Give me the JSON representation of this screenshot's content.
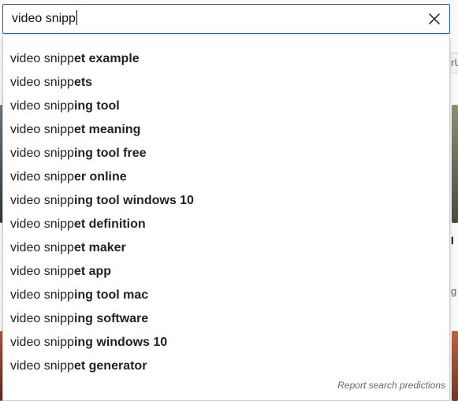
{
  "search": {
    "query": "video snipp",
    "placeholder": ""
  },
  "suggestions": [
    {
      "prefix": "video snipp",
      "completion": "et example"
    },
    {
      "prefix": "video snipp",
      "completion": "ets"
    },
    {
      "prefix": "video snipp",
      "completion": "ing tool"
    },
    {
      "prefix": "video snipp",
      "completion": "et meaning"
    },
    {
      "prefix": "video snipp",
      "completion": "ing tool free"
    },
    {
      "prefix": "video snipp",
      "completion": "er online"
    },
    {
      "prefix": "video snipp",
      "completion": "ing tool windows 10"
    },
    {
      "prefix": "video snipp",
      "completion": "et definition"
    },
    {
      "prefix": "video snipp",
      "completion": "et maker"
    },
    {
      "prefix": "video snipp",
      "completion": "et app"
    },
    {
      "prefix": "video snipp",
      "completion": "ing tool mac"
    },
    {
      "prefix": "video snipp",
      "completion": "ing software"
    },
    {
      "prefix": "video snipp",
      "completion": "ing windows 10"
    },
    {
      "prefix": "video snipp",
      "completion": "et generator"
    }
  ],
  "footer": {
    "report_label": "Report search predictions"
  },
  "background": {
    "text_fragment_1": "rU",
    "text_fragment_2": "l",
    "text_fragment_3": "g"
  },
  "icons": {
    "clear": "close-icon"
  },
  "colors": {
    "focus_border": "#1c62b9",
    "text": "#222222",
    "muted": "#666666"
  }
}
